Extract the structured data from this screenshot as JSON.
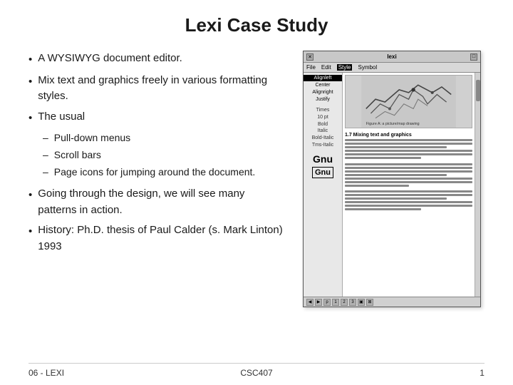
{
  "title": "Lexi Case Study",
  "bullets": [
    {
      "id": "b1",
      "text": "A WYSIWYG document editor."
    },
    {
      "id": "b2",
      "text": "Mix text and graphics freely in various formatting styles."
    },
    {
      "id": "b3",
      "text": "The usual",
      "subbullets": [
        {
          "id": "sb1",
          "text": "Pull-down menus"
        },
        {
          "id": "sb2",
          "text": "Scroll bars"
        },
        {
          "id": "sb3",
          "text": "Page icons for jumping around the document."
        }
      ]
    },
    {
      "id": "b4",
      "text": "Going through the design, we will see many patterns in action."
    },
    {
      "id": "b5",
      "text": "History: Ph.D. thesis of Paul Calder (s. Mark Linton) 1993"
    }
  ],
  "doc_window": {
    "title": "lexi",
    "menu_items": [
      "File",
      "Edit",
      "Style",
      "Symbol"
    ],
    "active_menu": "Style",
    "sidebar_items": [
      "Alignleft",
      "Center",
      "Alignright",
      "Justify"
    ],
    "sidebar_selected": "Alignleft",
    "gnu_labels": [
      "Gnu",
      "Gnu"
    ],
    "section_title": "1.7  Mixing text and graphics",
    "image_caption": "Figure A: a picture/map drawing"
  },
  "footer": {
    "left": "06 - LEXI",
    "center": "CSC407",
    "right": "1"
  }
}
